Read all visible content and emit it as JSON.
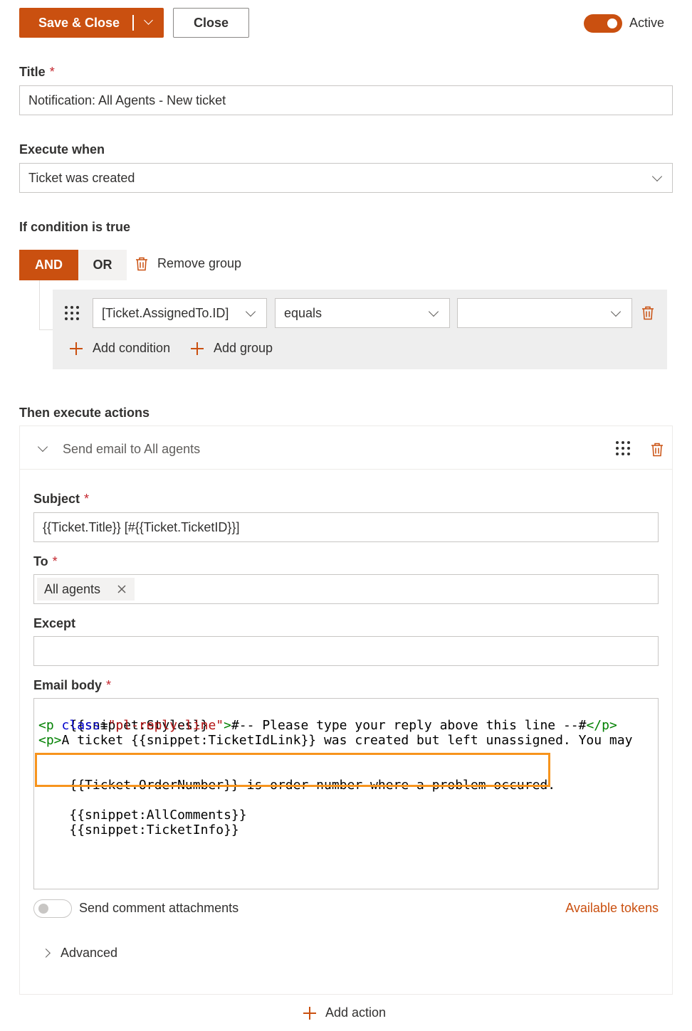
{
  "toolbar": {
    "save_close_label": "Save & Close",
    "close_label": "Close",
    "active_label": "Active"
  },
  "title_field": {
    "label": "Title",
    "required_mark": "*",
    "value": "Notification: All Agents - New ticket"
  },
  "execute_when": {
    "label": "Execute when",
    "value": "Ticket was created"
  },
  "condition": {
    "label": "If condition is true",
    "and_label": "AND",
    "or_label": "OR",
    "remove_group_label": "Remove group",
    "row": {
      "field": "[Ticket.AssignedTo.ID]",
      "operator": "equals",
      "value": ""
    },
    "add_condition_label": "Add condition",
    "add_group_label": "Add group"
  },
  "actions": {
    "label": "Then execute actions",
    "action_title": "Send email to All agents",
    "subject_label": "Subject",
    "subject_value": "{{Ticket.Title}} [#{{Ticket.TicketID}}]",
    "to_label": "To",
    "to_chip": "All agents",
    "except_label": "Except",
    "except_value": "",
    "body_label": "Email body",
    "body": {
      "line1": "{{snippet:Styles}}",
      "line2_tag_open": "<p",
      "line2_attr": "class",
      "line2_eq": "=",
      "line2_str": "\"pl-reply-line\"",
      "line2_close": ">",
      "line2_text": "#-- Please type your reply above this line --#",
      "line2_end_tag": "</p>",
      "line3_tag": "<p>",
      "line3_text": "A ticket {{snippet:TicketIdLink}} was created but left unassigned. You may",
      "highlight_line": "{{Ticket.OrderNumber}} is order number where a problem occured.",
      "line5": "{{snippet:AllComments}}",
      "line6": "{{snippet:TicketInfo}}"
    },
    "attachments_label": "Send comment attachments",
    "tokens_link": "Available tokens",
    "advanced_label": "Advanced",
    "add_action_label": "Add action"
  },
  "colors": {
    "accent": "#ca5010",
    "highlight_border": "#f7941d"
  }
}
